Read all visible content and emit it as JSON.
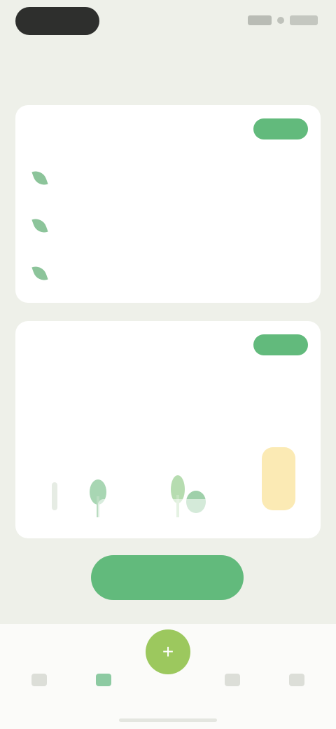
{
  "status": {
    "time": ""
  },
  "page": {
    "title": ""
  },
  "card1": {
    "title": "",
    "action_label": "",
    "items": [
      {
        "label": "",
        "value": ""
      },
      {
        "label": "",
        "value": ""
      },
      {
        "label": "",
        "value": ""
      }
    ]
  },
  "card2": {
    "title": "",
    "action_label": "",
    "stats": [
      {
        "value": "",
        "label": ""
      },
      {
        "value": "",
        "label": ""
      }
    ]
  },
  "overlay": {
    "line1": "",
    "line2": ""
  },
  "cta": {
    "label": ""
  },
  "tabs": [
    {
      "label": "",
      "icon": "home-icon"
    },
    {
      "label": "",
      "icon": "leaf-icon"
    },
    {
      "label": "",
      "icon": "plus-icon"
    },
    {
      "label": "",
      "icon": "chart-icon"
    },
    {
      "label": "",
      "icon": "profile-icon"
    }
  ],
  "colors": {
    "accent": "#62ba7c",
    "fab": "#9cc85e",
    "background": "#eef0e9",
    "card": "#ffffff"
  }
}
